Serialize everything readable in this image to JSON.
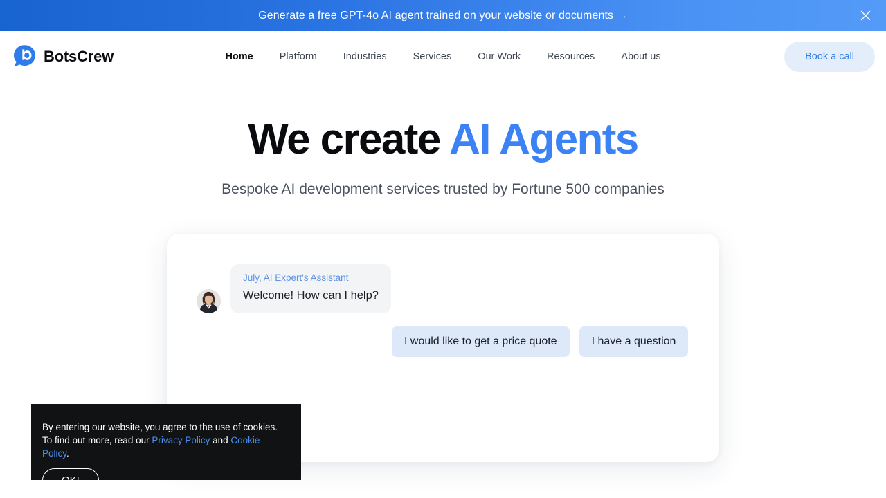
{
  "promo": {
    "text": "Generate a free GPT-4o AI agent trained on your website or documents →",
    "close_label": "close-icon",
    "gradient_from": "#1763cf",
    "gradient_to": "#549bf8"
  },
  "header": {
    "brand": "BotsCrew",
    "brand_icon": "botscrew-logo-icon",
    "nav": [
      {
        "label": "Home",
        "active": true
      },
      {
        "label": "Platform",
        "active": false
      },
      {
        "label": "Industries",
        "active": false
      },
      {
        "label": "Services",
        "active": false
      },
      {
        "label": "Our Work",
        "active": false
      },
      {
        "label": "Resources",
        "active": false
      },
      {
        "label": "About us",
        "active": false
      }
    ],
    "cta_label": "Book a call",
    "cta_bg": "#e4eefb",
    "cta_color": "#2f7bea"
  },
  "hero": {
    "title_plain": "We create ",
    "title_accent": "AI Agents",
    "accent_color": "#3b82f6",
    "subtitle": "Bespoke AI development services trusted by Fortune 500 companies"
  },
  "chat": {
    "avatar_alt": "July assistant avatar",
    "sender": "July, AI Expert's Assistant",
    "message": "Welcome! How can I help?",
    "bubble_bg": "#f3f4f6",
    "sender_color": "#5e93e8",
    "quick_replies": [
      "I would like to get a price quote",
      "I have a question"
    ],
    "quick_reply_bg": "#dde8f9"
  },
  "cookies": {
    "line1": "By entering our website, you agree to the use of cookies.",
    "line2_prefix": "To find out more, read our ",
    "privacy_link": "Privacy Policy",
    "line2_mid": " and ",
    "cookie_link": "Cookie Policy",
    "line2_suffix": ".",
    "ok_label": "OK!",
    "bg": "#111214",
    "link_color": "#4d8ff0"
  }
}
